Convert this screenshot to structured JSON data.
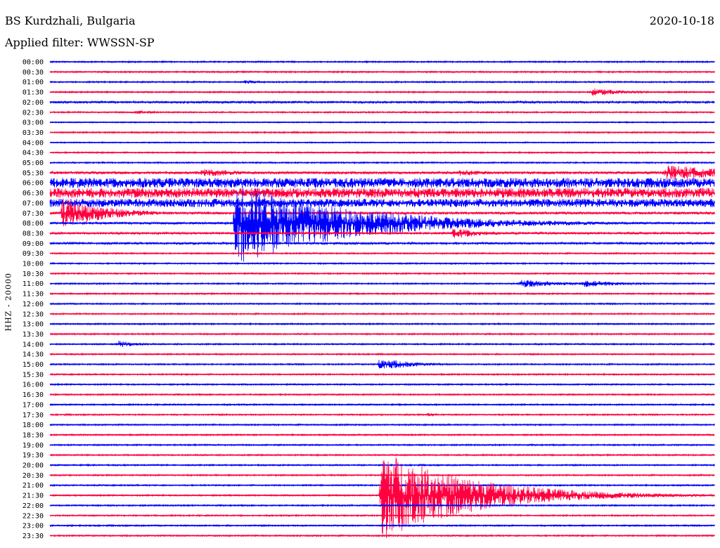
{
  "header": {
    "station": "BS Kurdzhali, Bulgaria",
    "date": "2020-10-18",
    "filter": "Applied filter: WWSSN-SP"
  },
  "chart_data": {
    "type": "line",
    "title": "BS Kurdzhali, Bulgaria",
    "ylabel": "HHZ - 20000",
    "colors": {
      "even_rows": "#0000ff",
      "odd_rows": "#ff0040"
    },
    "rows": [
      "00:00",
      "00:30",
      "01:00",
      "01:30",
      "02:00",
      "02:30",
      "03:00",
      "03:30",
      "04:00",
      "04:30",
      "05:00",
      "05:30",
      "06:00",
      "06:30",
      "07:00",
      "07:30",
      "08:00",
      "08:30",
      "09:00",
      "09:30",
      "10:00",
      "10:30",
      "11:00",
      "11:30",
      "12:00",
      "12:30",
      "13:00",
      "13:30",
      "14:00",
      "14:30",
      "15:00",
      "15:30",
      "16:00",
      "16:30",
      "17:00",
      "17:30",
      "18:00",
      "18:30",
      "19:00",
      "19:30",
      "20:00",
      "20:30",
      "21:00",
      "21:30",
      "22:00",
      "22:30",
      "23:00",
      "23:30"
    ],
    "row_duration_minutes": 30,
    "noise_amplitude": [
      1,
      1,
      1,
      1,
      1.5,
      1,
      0.8,
      1,
      0.8,
      1,
      1,
      2,
      7,
      7,
      6,
      2,
      1.5,
      1.5,
      1.5,
      1,
      1,
      1,
      1,
      1,
      1,
      1,
      1,
      1,
      1,
      1,
      1,
      1,
      1,
      1,
      1,
      1,
      1,
      1,
      1,
      1,
      1,
      1,
      1,
      1,
      1,
      1,
      1,
      1
    ],
    "events": [
      {
        "row": 2,
        "minute": 8.8,
        "amplitude": 3,
        "duration": 1
      },
      {
        "row": 3,
        "minute": 24.5,
        "amplitude": 6,
        "duration": 1.5
      },
      {
        "row": 5,
        "minute": 3.9,
        "amplitude": 3,
        "duration": 1
      },
      {
        "row": 11,
        "minute": 6.9,
        "amplitude": 6,
        "duration": 2
      },
      {
        "row": 11,
        "minute": 18.5,
        "amplitude": 5,
        "duration": 1.5
      },
      {
        "row": 11,
        "minute": 27.8,
        "amplitude": 12,
        "duration": 3
      },
      {
        "row": 15,
        "minute": 0.6,
        "amplitude": 22,
        "duration": 2
      },
      {
        "row": 16,
        "minute": 8.4,
        "amplitude": 60,
        "duration": 5
      },
      {
        "row": 17,
        "minute": 18.2,
        "amplitude": 8,
        "duration": 1.5
      },
      {
        "row": 22,
        "minute": 21.3,
        "amplitude": 6,
        "duration": 2
      },
      {
        "row": 22,
        "minute": 24.1,
        "amplitude": 5,
        "duration": 2
      },
      {
        "row": 28,
        "minute": 3.1,
        "amplitude": 5,
        "duration": 1
      },
      {
        "row": 30,
        "minute": 14.9,
        "amplitude": 9,
        "duration": 1.5
      },
      {
        "row": 35,
        "minute": 17.1,
        "amplitude": 3,
        "duration": 0.5
      },
      {
        "row": 43,
        "minute": 15.0,
        "amplitude": 65,
        "duration": 4
      }
    ]
  }
}
